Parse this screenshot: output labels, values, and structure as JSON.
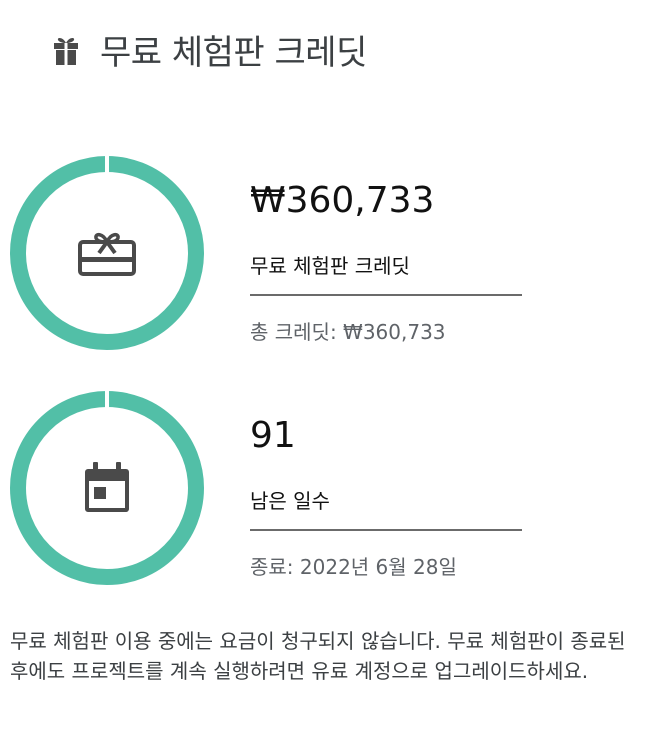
{
  "header": {
    "title": "무료 체험판 크레딧",
    "icon": "gift-icon"
  },
  "colors": {
    "ring": "#52bfa7",
    "ring_gap": "#ffffff",
    "icon": "#4a4a4a"
  },
  "credits": {
    "amount": "₩360,733",
    "label": "무료 체험판 크레딧",
    "total": "총 크레딧: ₩360,733",
    "remaining_fraction": 1.0,
    "icon": "card-giftcard-icon"
  },
  "days": {
    "remaining": "91",
    "label": "남은 일수",
    "end_date": "종료: 2022년 6월 28일",
    "remaining_fraction": 1.0,
    "icon": "calendar-icon"
  },
  "footer": {
    "text": "무료 체험판 이용 중에는 요금이 청구되지 않습니다. 무료 체험판이 종료된 후에도 프로젝트를 계속 실행하려면 유료 계정으로 업그레이드하세요."
  }
}
